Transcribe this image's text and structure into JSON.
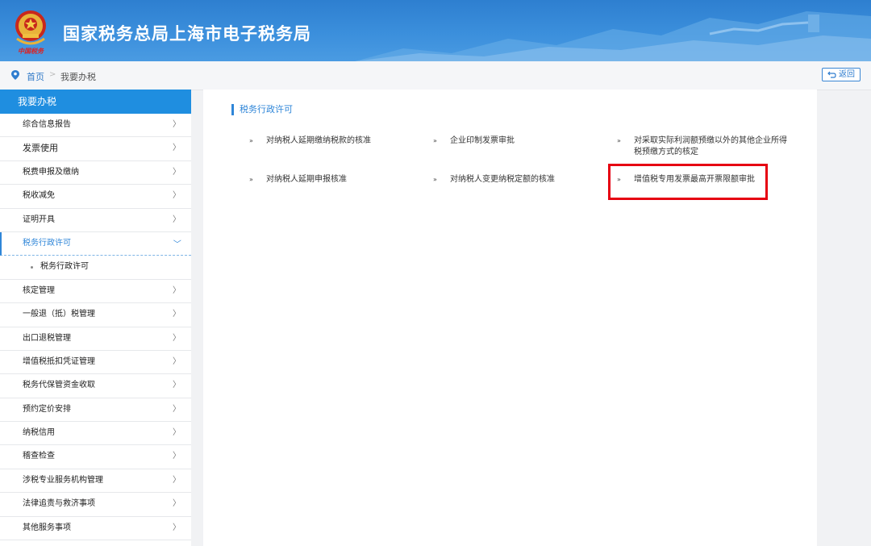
{
  "header": {
    "site_title": "国家税务总局上海市电子税务局",
    "emblem_caption": "中国税务"
  },
  "breadcrumb": {
    "home": "首页",
    "separator": ">",
    "current": "我要办税",
    "back_label": "返回"
  },
  "sidebar": {
    "title": "我要办税",
    "items": [
      {
        "label": "综合信息报告"
      },
      {
        "label": "发票使用"
      },
      {
        "label": "税费申报及缴纳"
      },
      {
        "label": "税收减免"
      },
      {
        "label": "证明开具"
      },
      {
        "label": "税务行政许可"
      },
      {
        "label": "核定管理"
      },
      {
        "label": "一般退（抵）税管理"
      },
      {
        "label": "出口退税管理"
      },
      {
        "label": "增值税抵扣凭证管理"
      },
      {
        "label": "税务代保管资金收取"
      },
      {
        "label": "预约定价安排"
      },
      {
        "label": "纳税信用"
      },
      {
        "label": "稽查检查"
      },
      {
        "label": "涉税专业服务机构管理"
      },
      {
        "label": "法律追责与救济事项"
      },
      {
        "label": "其他服务事项"
      }
    ],
    "active_sub": "税务行政许可",
    "arrow": "〉",
    "expanded_arrow": "〉"
  },
  "main": {
    "section_title": "税务行政许可",
    "bullet": "»",
    "links": [
      {
        "label": "对纳税人延期缴纳税款的核准"
      },
      {
        "label": "企业印制发票审批"
      },
      {
        "label_line1": "对采取实际利润额预缴以外的其他企业所得",
        "label_line2": "税预缴方式的核定"
      },
      {
        "label": "对纳税人延期申报核准"
      },
      {
        "label": "对纳税人变更纳税定额的核准"
      },
      {
        "label": "增值税专用发票最高开票限额审批"
      }
    ]
  },
  "colors": {
    "header_blue": "#3b8fdc",
    "accent_blue": "#2f86d8",
    "highlight_red": "#e60012"
  }
}
